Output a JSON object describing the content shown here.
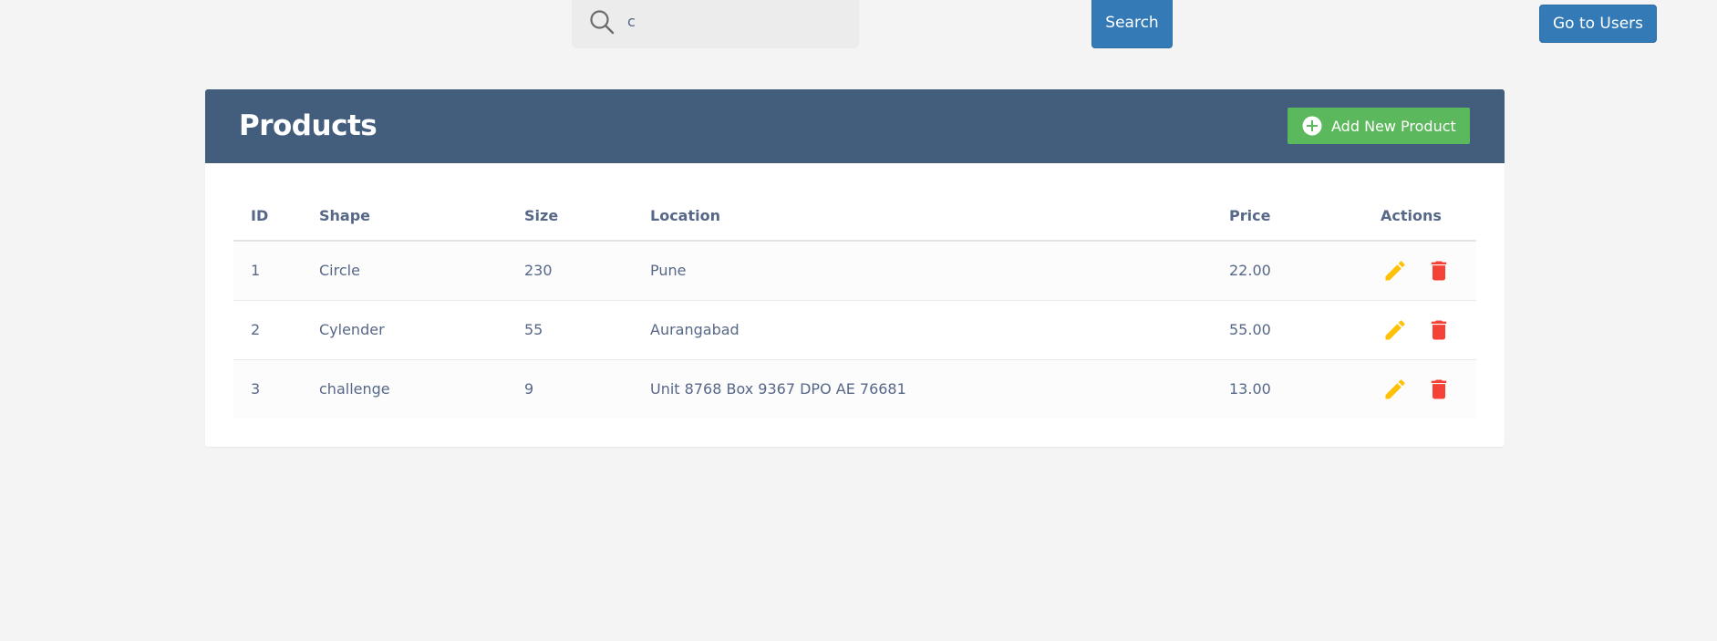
{
  "search": {
    "value": "c",
    "button_label": "Search"
  },
  "nav": {
    "users_button_label": "Go to Users"
  },
  "panel": {
    "title": "Products",
    "add_button_label": "Add New Product"
  },
  "table": {
    "headers": [
      "ID",
      "Shape",
      "Size",
      "Location",
      "Price",
      "Actions"
    ],
    "rows": [
      {
        "id": "1",
        "shape": "Circle",
        "size": "230",
        "location": "Pune",
        "price": "22.00"
      },
      {
        "id": "2",
        "shape": "Cylender",
        "size": "55",
        "location": "Aurangabad",
        "price": "55.00"
      },
      {
        "id": "3",
        "shape": "challenge",
        "size": "9",
        "location": "Unit 8768 Box 9367 DPO AE 76681",
        "price": "13.00"
      }
    ]
  },
  "icons": {
    "search": "search-icon",
    "add": "plus-circle-icon",
    "edit": "pencil-icon",
    "delete": "trash-icon"
  },
  "colors": {
    "header_bg": "#435d7d",
    "primary_button": "#337ab7",
    "add_button": "#5cb85c",
    "edit_icon": "#ffc107",
    "delete_icon": "#f44336",
    "text": "#566787"
  }
}
